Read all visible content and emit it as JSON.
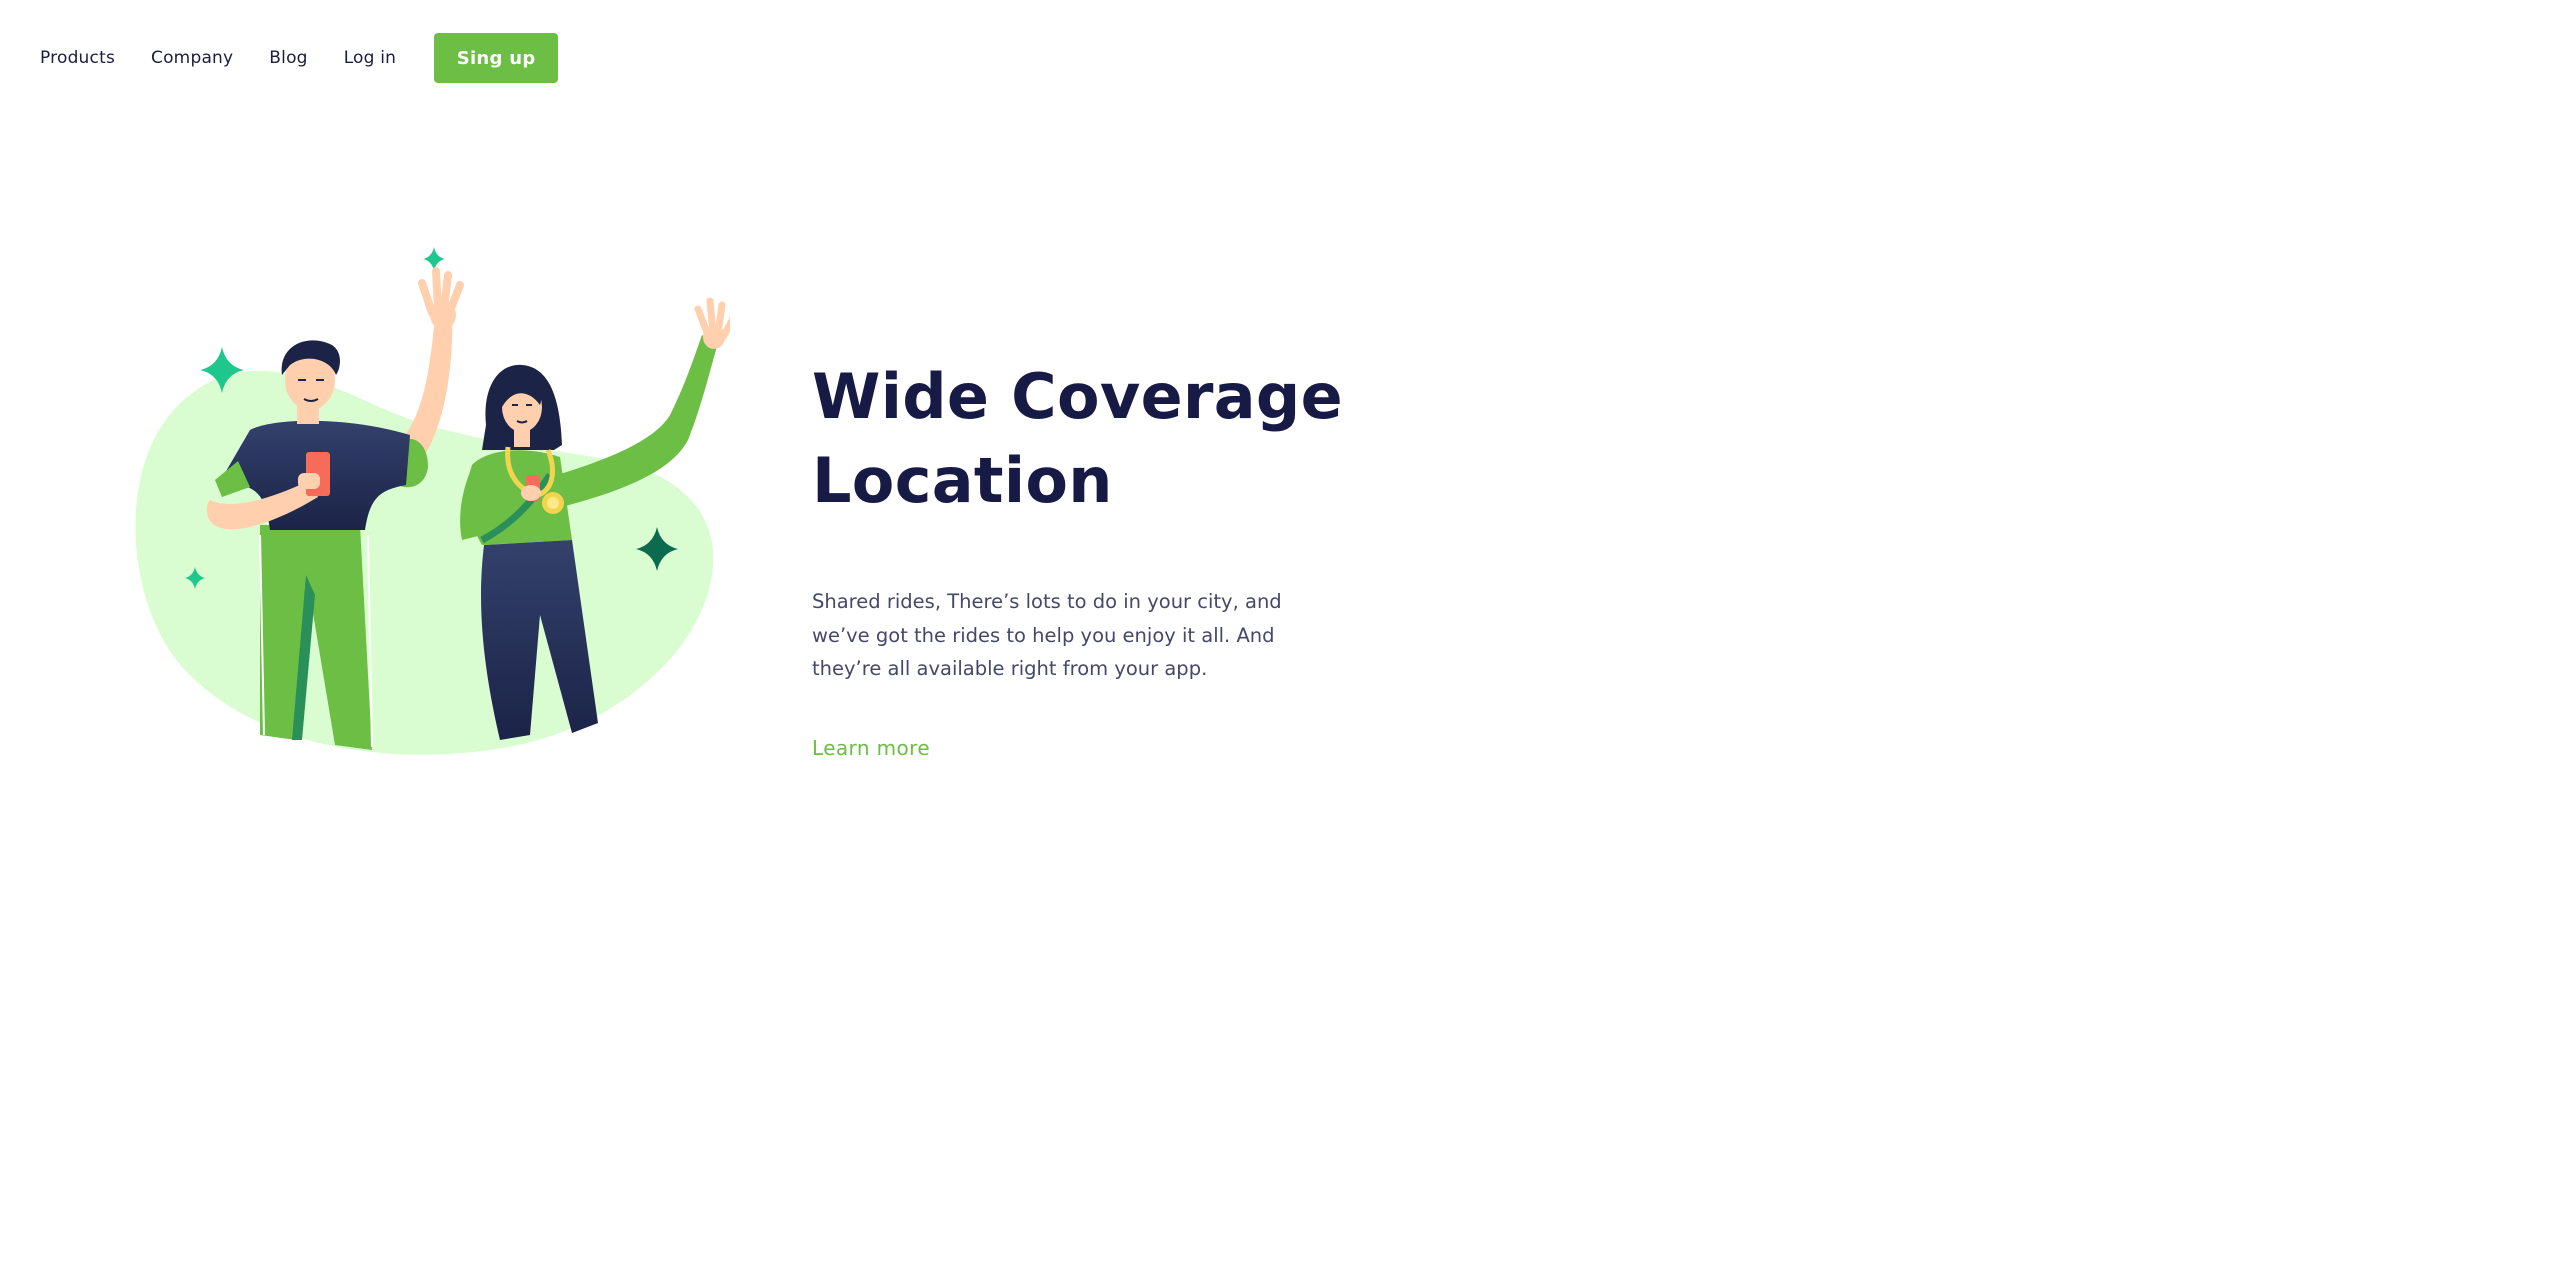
{
  "nav": {
    "products": "Products",
    "company": "Company",
    "blog": "Blog",
    "login": "Log in",
    "signup": "Sing up"
  },
  "hero": {
    "title_line1": "Wide Coverage",
    "title_line2": "Location",
    "description": "Shared rides, There’s lots to do in your city, and we’ve got the rides to help you enjoy it all. And they’re all available right from your app.",
    "cta": "Learn more"
  },
  "colors": {
    "accent": "#6cbe45",
    "heading": "#161a44",
    "body_text": "#454868",
    "blob": "#d9fdd0",
    "sparkle": "#1ec88c",
    "sparkle_dark": "#0c6a4f",
    "navy": "#27325a",
    "skin": "#ffcfae"
  },
  "icons": {
    "illustration": "two-people-waving-illustration",
    "sparkle": "sparkle-icon"
  }
}
